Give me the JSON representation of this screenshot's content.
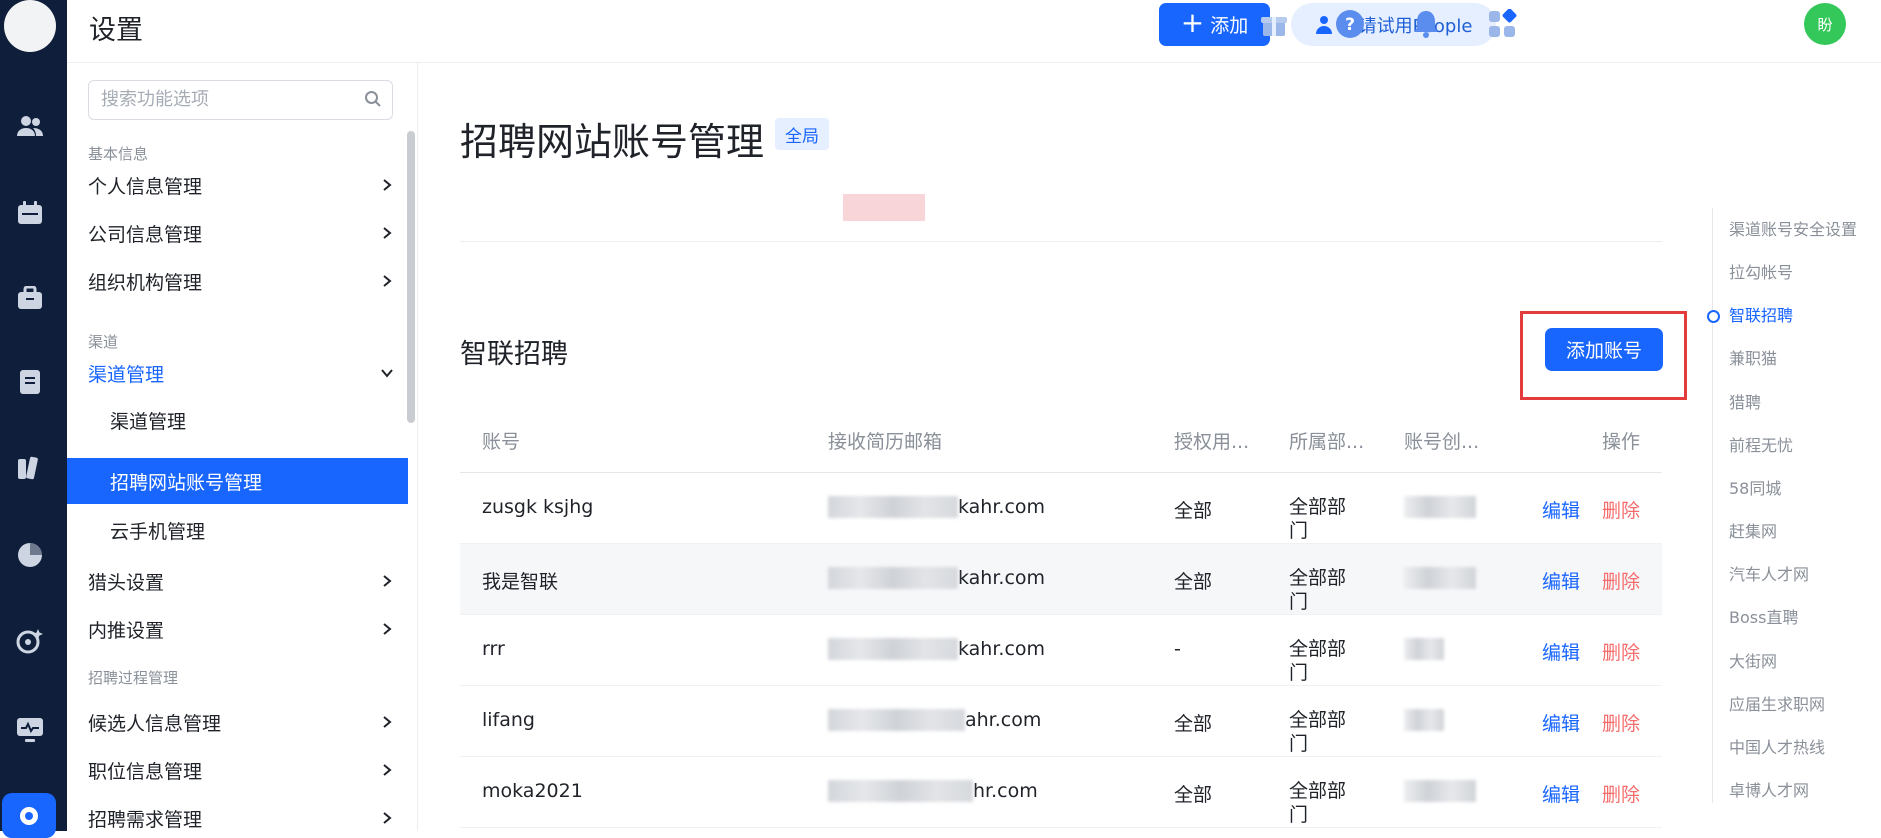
{
  "header": {
    "title": "设置",
    "add_label": "添加",
    "trial_label": "申请试用People",
    "user_initial": "盼"
  },
  "sidebar": {
    "search_placeholder": "搜索功能选项",
    "sections": [
      {
        "label": "基本信息"
      },
      {
        "label": "渠道"
      },
      {
        "label": "招聘过程管理"
      }
    ],
    "items": [
      {
        "label": "个人信息管理"
      },
      {
        "label": "公司信息管理"
      },
      {
        "label": "组织机构管理"
      },
      {
        "label": "渠道管理"
      },
      {
        "label": "渠道管理"
      },
      {
        "label": "招聘网站账号管理"
      },
      {
        "label": "云手机管理"
      },
      {
        "label": "猎头设置"
      },
      {
        "label": "内推设置"
      },
      {
        "label": "候选人信息管理"
      },
      {
        "label": "职位信息管理"
      },
      {
        "label": "招聘需求管理"
      }
    ]
  },
  "main": {
    "title": "招聘网站账号管理",
    "badge": "全局",
    "section_title": "智联招聘",
    "add_account_label": "添加账号",
    "columns": [
      "账号",
      "接收简历邮箱",
      "授权用...",
      "所属部...",
      "账号创...",
      "操作"
    ],
    "rows": [
      {
        "account": "zusgk ksjhg",
        "email_suffix": "kahr.com",
        "auth": "全部",
        "dept": "全部部门",
        "edit": "编辑",
        "delete": "删除"
      },
      {
        "account": "我是智联",
        "email_suffix": "kahr.com",
        "auth": "全部",
        "dept": "全部部门",
        "edit": "编辑",
        "delete": "删除"
      },
      {
        "account": "rrr",
        "email_suffix": "kahr.com",
        "auth": "-",
        "dept": "全部部门",
        "edit": "编辑",
        "delete": "删除"
      },
      {
        "account": "lifang",
        "email_suffix": "ahr.com",
        "auth": "全部",
        "dept": "全部部门",
        "edit": "编辑",
        "delete": "删除"
      },
      {
        "account": "moka2021",
        "email_suffix": "hr.com",
        "auth": "全部",
        "dept": "全部部门",
        "edit": "编辑",
        "delete": "删除"
      }
    ]
  },
  "anchor_nav": {
    "active_index": 2,
    "items": [
      {
        "label": "渠道账号安全设置"
      },
      {
        "label": "拉勾帐号"
      },
      {
        "label": "智联招聘"
      },
      {
        "label": "兼职猫"
      },
      {
        "label": "猎聘"
      },
      {
        "label": "前程无忧"
      },
      {
        "label": "58同城"
      },
      {
        "label": "赶集网"
      },
      {
        "label": "汽车人才网"
      },
      {
        "label": "Boss直聘"
      },
      {
        "label": "大街网"
      },
      {
        "label": "应届生求职网"
      },
      {
        "label": "中国人才热线"
      },
      {
        "label": "卓博人才网"
      }
    ]
  },
  "colors": {
    "accent": "#1966ff",
    "rail": "#0f1e3a",
    "danger": "#f56c6c",
    "highlight_box": "#e23c3c"
  }
}
